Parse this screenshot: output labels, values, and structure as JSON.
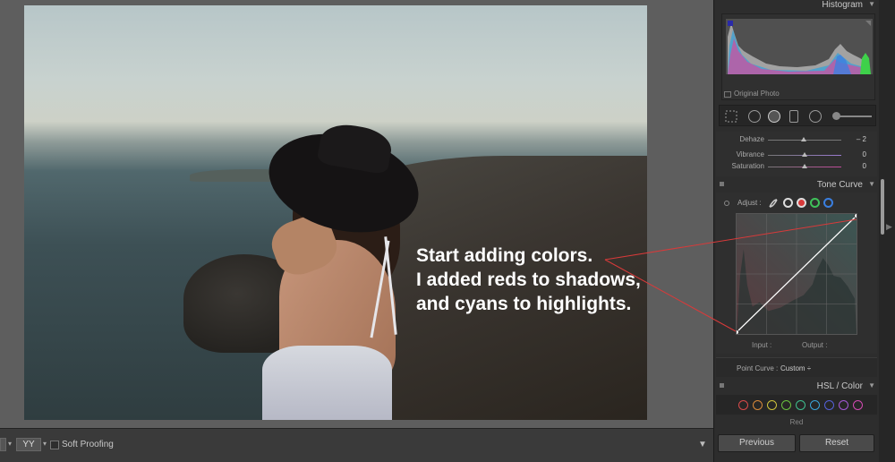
{
  "annotation": {
    "lines": [
      "Start adding colors.",
      "I added reds to shadows,",
      "and cyans to highlights."
    ]
  },
  "toolbar": {
    "view_button_label": "YY",
    "soft_proofing_label": "Soft Proofing",
    "menu_arrow": "▼"
  },
  "panel": {
    "histogram": {
      "title": "Histogram",
      "original_photo_label": "Original Photo"
    },
    "presence": {
      "dehaze_label": "Dehaze",
      "dehaze_value": "– 2",
      "dehaze_level": -2,
      "vibrance_label": "Vibrance",
      "vibrance_value": "0",
      "saturation_label": "Saturation",
      "saturation_value": "0"
    },
    "tone_curve": {
      "title": "Tone Curve",
      "adjust_label": "Adjust :",
      "input_label": "Input :",
      "output_label": "Output :",
      "point_curve_label": "Point Curve :",
      "point_curve_value": "Custom ÷"
    },
    "hsl": {
      "title": "HSL / Color",
      "red_label": "Red",
      "dot_colors": [
        "#d94a4a",
        "#d98a3a",
        "#cfc33b",
        "#6ac23f",
        "#3fbf8f",
        "#3aa4d9",
        "#5560d9",
        "#a55ad9",
        "#d44ab4"
      ]
    },
    "buttons": {
      "previous": "Previous",
      "reset": "Reset"
    }
  },
  "colors": {
    "canvas_bg": "#5e5e5e",
    "panel_bg": "#2d2d2d",
    "callout_line": "#d83a3a"
  }
}
